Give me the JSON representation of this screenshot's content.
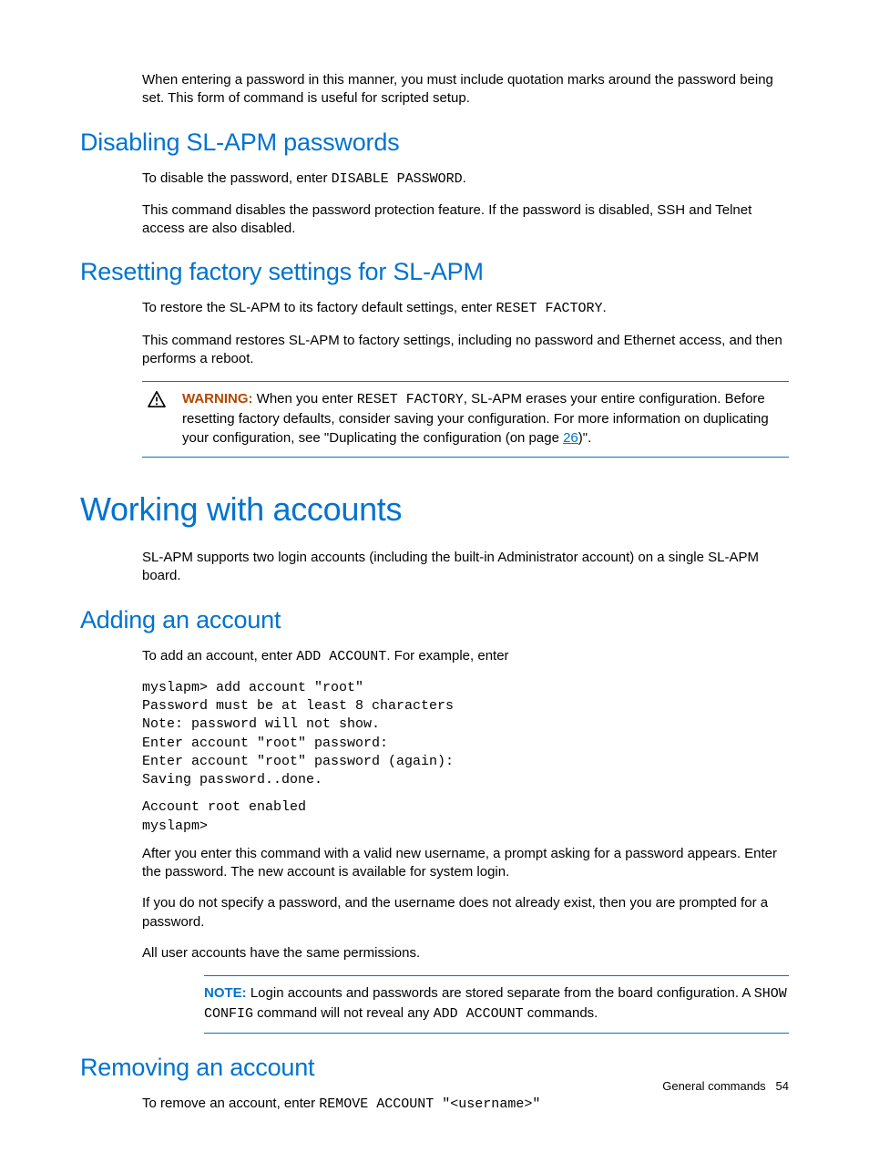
{
  "intro_para": "When entering a password in this manner, you must include quotation marks around the password being set. This form of command is useful for scripted setup.",
  "sec1": {
    "heading": "Disabling SL-APM passwords",
    "p1_pre": "To disable the password, enter ",
    "p1_code": "DISABLE PASSWORD",
    "p1_post": ".",
    "p2": "This command disables the password protection feature. If the password is disabled, SSH and Telnet access are also disabled."
  },
  "sec2": {
    "heading": "Resetting factory settings for SL-APM",
    "p1_pre": "To restore the SL-APM to its factory default settings, enter ",
    "p1_code": "RESET FACTORY",
    "p1_post": ".",
    "p2": "This command restores SL-APM to factory settings, including no password and Ethernet access, and then performs a reboot.",
    "warn_label": "WARNING:",
    "warn_pre": "  When you enter ",
    "warn_code": "RESET FACTORY",
    "warn_mid": ", SL-APM erases your entire configuration. Before resetting factory defaults, consider saving your configuration. For more information on duplicating your configuration, see \"Duplicating the configuration (on page ",
    "warn_link": "26",
    "warn_post": ")\"."
  },
  "sec3": {
    "heading": "Working with accounts",
    "p1": "SL-APM supports two login accounts (including the built-in Administrator account) on a single SL-APM board."
  },
  "sec4": {
    "heading": "Adding an account",
    "p1_pre": "To add an account, enter ",
    "p1_code": "ADD ACCOUNT",
    "p1_post": ". For example, enter",
    "code1": "myslapm> add account \"root\"\nPassword must be at least 8 characters\nNote: password will not show.\nEnter account \"root\" password:\nEnter account \"root\" password (again):\nSaving password..done.",
    "code2": "Account root enabled\nmyslapm>",
    "p2": "After you enter this command with a valid new username, a prompt asking for a password appears. Enter the password. The new account is available for system login.",
    "p3": "If you do not specify a password, and the username does not already exist, then you are prompted for a password.",
    "p4": "All user accounts have the same permissions.",
    "note_label": "NOTE:",
    "note_pre": "  Login accounts and passwords are stored separate from the board configuration. A ",
    "note_code1": "SHOW CONFIG",
    "note_mid": " command will not reveal any ",
    "note_code2": "ADD ACCOUNT",
    "note_post": " commands."
  },
  "sec5": {
    "heading": "Removing an account",
    "p1_pre": "To remove an account, enter ",
    "p1_code": "REMOVE ACCOUNT \"<username>\""
  },
  "footer": {
    "text": "General commands",
    "page": "54"
  }
}
